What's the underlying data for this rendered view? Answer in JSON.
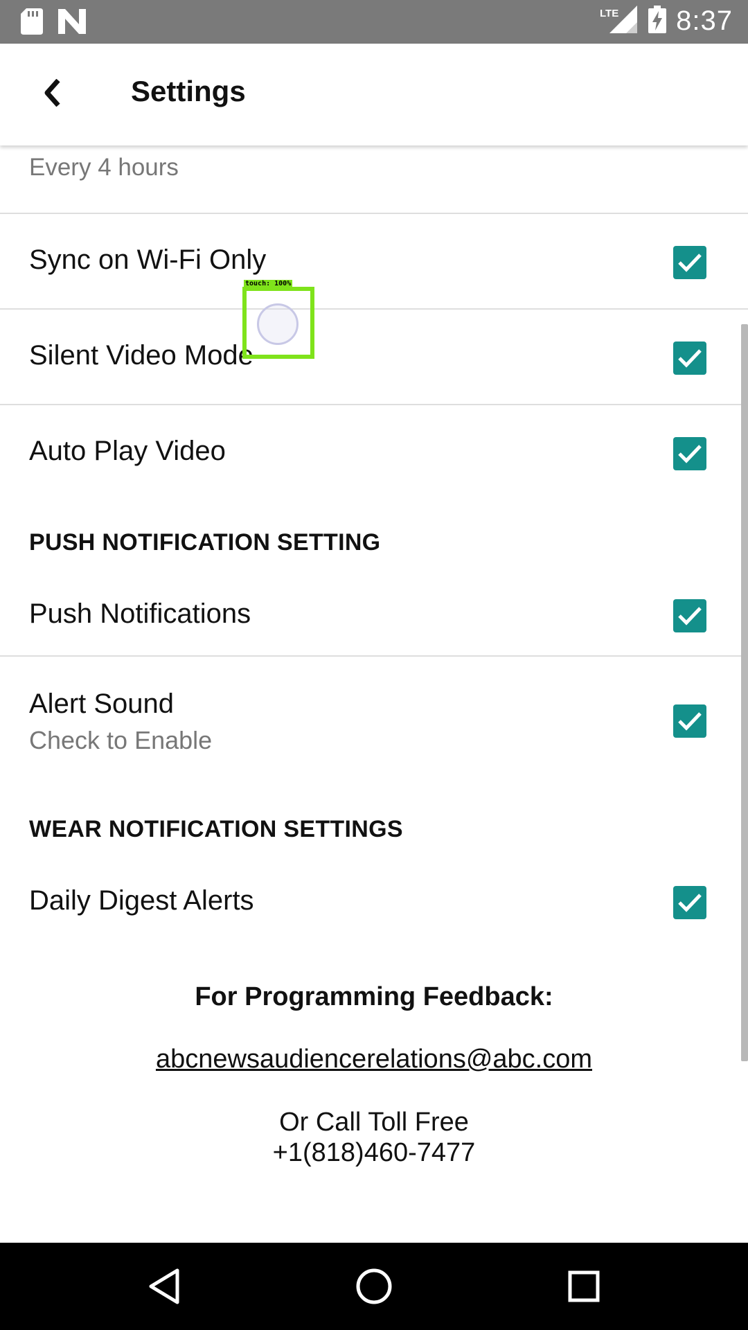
{
  "status_bar": {
    "time": "8:37",
    "network": "LTE",
    "icons": [
      "sd-card-icon",
      "n-notification-icon",
      "lte-signal-icon",
      "battery-charging-icon"
    ]
  },
  "app_bar": {
    "back_label": "❮",
    "title": "Settings"
  },
  "sync_interval": {
    "value": "Every 4 hours"
  },
  "settings": {
    "sync_wifi": {
      "label": "Sync on Wi-Fi Only",
      "checked": true
    },
    "silent_video": {
      "label": "Silent Video Mode",
      "checked": true
    },
    "auto_play": {
      "label": "Auto Play Video",
      "checked": true
    }
  },
  "push_section": {
    "header": "PUSH NOTIFICATION SETTING",
    "push_notifications": {
      "label": "Push Notifications",
      "checked": true
    },
    "alert_sound": {
      "label": "Alert Sound",
      "sublabel": "Check to Enable",
      "checked": true
    }
  },
  "wear_section": {
    "header": "WEAR NOTIFICATION SETTINGS",
    "daily_digest": {
      "label": "Daily Digest Alerts",
      "checked": true
    }
  },
  "feedback": {
    "title": "For Programming Feedback:",
    "email": "abcnewsaudiencerelations@abc.com",
    "call_line1": "Or Call Toll Free",
    "call_line2": "+1(818)460-7477"
  },
  "touch_overlay": {
    "label": "touch:  100%"
  },
  "colors": {
    "checkbox": "#14908b",
    "status_bar": "#7a7a7a",
    "touch_box": "#7fe31b"
  }
}
